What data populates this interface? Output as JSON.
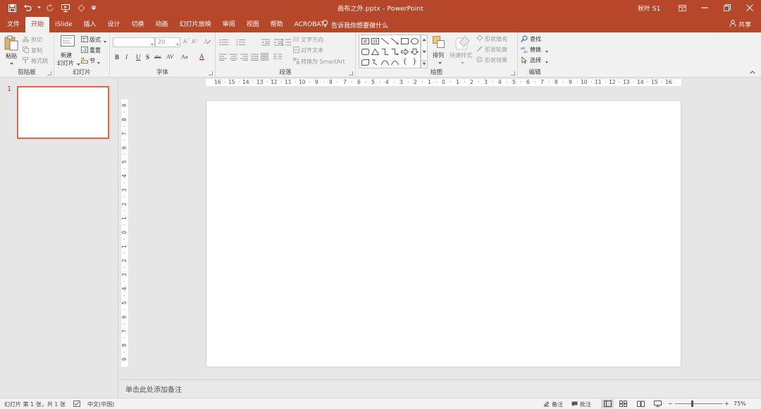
{
  "window": {
    "doc_title": "画布之外.pptx - PowerPoint",
    "user": "秋叶 S1",
    "qat_icons": [
      "save-icon",
      "undo-icon",
      "redo-icon",
      "start-from-beginning-icon",
      "touch-mode-icon",
      "customize-qat-icon"
    ]
  },
  "tabs": [
    {
      "label": "文件",
      "active": false
    },
    {
      "label": "开始",
      "active": true
    },
    {
      "label": "iSlide",
      "active": false
    },
    {
      "label": "插入",
      "active": false
    },
    {
      "label": "设计",
      "active": false
    },
    {
      "label": "切换",
      "active": false
    },
    {
      "label": "动画",
      "active": false
    },
    {
      "label": "幻灯片放映",
      "active": false
    },
    {
      "label": "审阅",
      "active": false
    },
    {
      "label": "视图",
      "active": false
    },
    {
      "label": "帮助",
      "active": false
    },
    {
      "label": "ACROBAT",
      "active": false
    }
  ],
  "tellme": "告诉我你想要做什么",
  "share": "共享",
  "ribbon": {
    "clipboard": {
      "label": "剪贴板",
      "paste": "粘贴",
      "cut": "剪切",
      "copy": "复制",
      "format_painter": "格式刷"
    },
    "slides": {
      "label": "幻灯片",
      "new_slide_line1": "新建",
      "new_slide_line2": "幻灯片",
      "layout": "版式",
      "reset": "重置",
      "section": "节"
    },
    "font": {
      "label": "字体",
      "font_name": "",
      "font_size": "20",
      "buttons": [
        "B",
        "I",
        "U",
        "S",
        "abc",
        "AV",
        "Aa",
        "A"
      ]
    },
    "paragraph": {
      "label": "段落",
      "text_direction": "文字方向",
      "align_text": "对齐文本",
      "convert_smartart": "转换为 SmartArt"
    },
    "drawing": {
      "label": "绘图",
      "arrange": "排列",
      "quick_styles": "快速样式",
      "shape_fill": "形状填充",
      "shape_outline": "形状轮廓",
      "shape_effects": "形状效果"
    },
    "editing": {
      "label": "编辑",
      "find": "查找",
      "replace": "替换",
      "select": "选择"
    }
  },
  "thumbnails": [
    {
      "number": "1",
      "selected": true
    }
  ],
  "ruler": {
    "horizontal": [
      "16",
      "15",
      "14",
      "13",
      "12",
      "11",
      "10",
      "9",
      "8",
      "7",
      "6",
      "5",
      "4",
      "3",
      "2",
      "1",
      "0",
      "1",
      "2",
      "3",
      "4",
      "5",
      "6",
      "7",
      "8",
      "9",
      "10",
      "11",
      "12",
      "13",
      "14",
      "15",
      "16"
    ],
    "vertical": [
      "9",
      "8",
      "7",
      "6",
      "5",
      "4",
      "3",
      "2",
      "1",
      "0",
      "1",
      "2",
      "3",
      "4",
      "5",
      "6",
      "7",
      "8",
      "9"
    ]
  },
  "notes_placeholder": "单击此处添加备注",
  "status": {
    "slide_info": "幻灯片 第 1 张，共 1 张",
    "language": "中文(中国)",
    "notes": "备注",
    "comments": "批注",
    "zoom": "75%",
    "zoom_level": 0.75
  },
  "colors": {
    "accent": "#b7472a",
    "ribbon_bg": "#f1f1f1",
    "workspace": "#e6e6e6",
    "thumb_border": "#d9694d"
  }
}
